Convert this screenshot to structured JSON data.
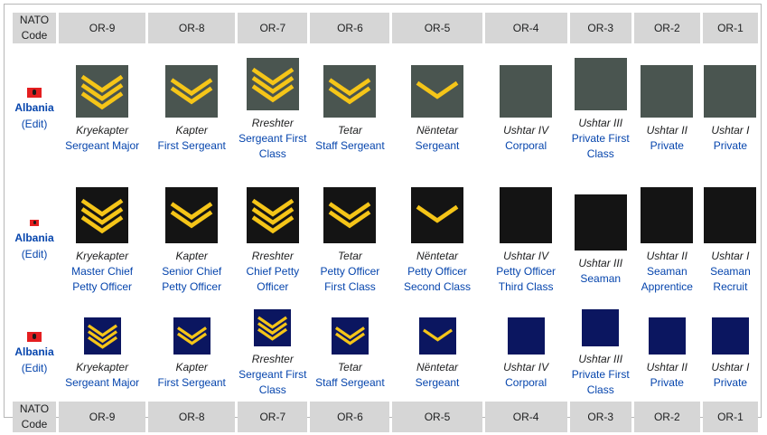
{
  "header": {
    "code_line1": "NATO",
    "code_line2": "Code",
    "grades": [
      "OR-9",
      "OR-8",
      "OR-7",
      "OR-6",
      "OR-5",
      "OR-4",
      "OR-3",
      "OR-2",
      "OR-1"
    ]
  },
  "rows": [
    {
      "branch": "army",
      "country": "Albania",
      "edit": "(Edit)",
      "cells": [
        {
          "alb": "Kryekapter",
          "eng": "Sergeant Major",
          "chevrons": 3
        },
        {
          "alb": "Kapter",
          "eng": "First Sergeant",
          "chevrons": 2
        },
        {
          "alb": "Rreshter",
          "eng": "Sergeant First Class",
          "chevrons": 3
        },
        {
          "alb": "Tetar",
          "eng": "Staff Sergeant",
          "chevrons": 2
        },
        {
          "alb": "Nëntetar",
          "eng": "Sergeant",
          "chevrons": 1
        },
        {
          "alb": "Ushtar IV",
          "eng": "Corporal",
          "chevrons": 0
        },
        {
          "alb": "Ushtar III",
          "eng": "Private First Class",
          "chevrons": 0
        },
        {
          "alb": "Ushtar II",
          "eng": "Private",
          "chevrons": 0
        },
        {
          "alb": "Ushtar I",
          "eng": "Private",
          "chevrons": 0
        }
      ]
    },
    {
      "branch": "navy",
      "country": "Albania",
      "edit": "(Edit)",
      "cells": [
        {
          "alb": "Kryekapter",
          "eng": "Master Chief Petty Officer",
          "chevrons": 3
        },
        {
          "alb": "Kapter",
          "eng": "Senior Chief Petty Officer",
          "chevrons": 2
        },
        {
          "alb": "Rreshter",
          "eng": "Chief Petty Officer",
          "chevrons": 3
        },
        {
          "alb": "Tetar",
          "eng": "Petty Officer First Class",
          "chevrons": 2
        },
        {
          "alb": "Nëntetar",
          "eng": "Petty Officer Second Class",
          "chevrons": 1
        },
        {
          "alb": "Ushtar IV",
          "eng": "Petty Officer Third Class",
          "chevrons": 0
        },
        {
          "alb": "Ushtar III",
          "eng": "Seaman",
          "chevrons": 0
        },
        {
          "alb": "Ushtar II",
          "eng": "Seaman Apprentice",
          "chevrons": 0
        },
        {
          "alb": "Ushtar I",
          "eng": "Seaman Recruit",
          "chevrons": 0
        }
      ]
    },
    {
      "branch": "air",
      "country": "Albania",
      "edit": "(Edit)",
      "cells": [
        {
          "alb": "Kryekapter",
          "eng": "Sergeant Major",
          "chevrons": 3
        },
        {
          "alb": "Kapter",
          "eng": "First Sergeant",
          "chevrons": 2
        },
        {
          "alb": "Rreshter",
          "eng": "Sergeant First Class",
          "chevrons": 3
        },
        {
          "alb": "Tetar",
          "eng": "Staff Sergeant",
          "chevrons": 2
        },
        {
          "alb": "Nëntetar",
          "eng": "Sergeant",
          "chevrons": 1
        },
        {
          "alb": "Ushtar IV",
          "eng": "Corporal",
          "chevrons": 0
        },
        {
          "alb": "Ushtar III",
          "eng": "Private First Class",
          "chevrons": 0
        },
        {
          "alb": "Ushtar II",
          "eng": "Private",
          "chevrons": 0
        },
        {
          "alb": "Ushtar I",
          "eng": "Private",
          "chevrons": 0
        }
      ]
    }
  ],
  "colors": {
    "header_bg": "#d6d6d6",
    "link": "#0645ad",
    "chevron": "#f5c518",
    "army_insignia": "#4a5550",
    "navy_insignia": "#141414",
    "air_insignia": "#0b1660"
  },
  "icons": {
    "flag": "albania-flag-icon",
    "chevron": "chevron-insignia-icon"
  }
}
